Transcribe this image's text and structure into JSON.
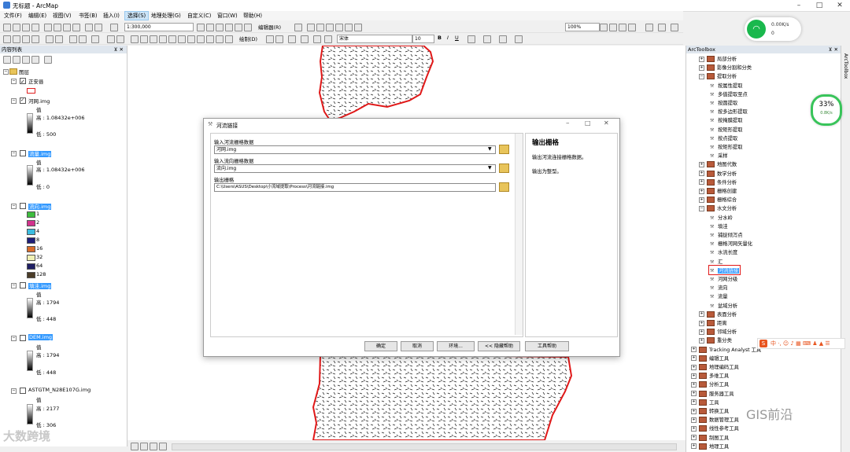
{
  "window": {
    "title": "无标题 - ArcMap"
  },
  "menu": [
    "文件(F)",
    "编辑(E)",
    "视图(V)",
    "书签(B)",
    "插入(I)",
    "选择(S)",
    "地理处理(G)",
    "自定义(C)",
    "窗口(W)",
    "帮助(H)"
  ],
  "toolbar": {
    "scale": "1:300,000",
    "editor": "编辑器(R)",
    "zoom": "100%",
    "drawing": "绘制(D)",
    "font": "宋体",
    "font_size": "10"
  },
  "network": {
    "up": "0.00K/s",
    "down": "0"
  },
  "toc": {
    "title": "内容列表",
    "root": "图层",
    "layers": [
      {
        "name": "正安县"
      },
      {
        "name": "河网.img",
        "value_label": "值",
        "high": "高 : 1.08432e+006",
        "low": "低 : 500"
      },
      {
        "name": "流量.img",
        "value_label": "值",
        "high": "高 : 1.08432e+006",
        "low": "低 : 0"
      },
      {
        "name": "流向.img",
        "classes": [
          "1",
          "2",
          "4",
          "8",
          "16",
          "32",
          "64",
          "128"
        ]
      },
      {
        "name": "填洼.img",
        "value_label": "值",
        "high": "高 : 1794",
        "low": "低 : 448"
      },
      {
        "name": "DEM.img",
        "value_label": "值",
        "high": "高 : 1794",
        "low": "低 : 448"
      },
      {
        "name": "ASTGTM_N28E107G.img",
        "value_label": "值",
        "high": "高 : 2177",
        "low": "低 : 306"
      }
    ],
    "colors": {
      "1": "#3ebc3e",
      "2": "#d2328c",
      "4": "#3cbde0",
      "8": "#1e1e78",
      "16": "#d96c2a",
      "32": "#f0f0b4",
      "64": "#1e1e64",
      "128": "#4b3c28"
    }
  },
  "dialog": {
    "title": "河流链接",
    "label1": "输入河流栅格数据",
    "value1": "河网.img",
    "label2": "输入流向栅格数据",
    "value2": "流向.img",
    "label3": "输出栅格",
    "value3": "C:\\Users\\ASUS\\Desktop\\小流域提取\\Process\\河流链接.img",
    "help_title": "输出栅格",
    "help_text1": "输出河流连接栅格数据。",
    "help_text2": "输出为整型。",
    "buttons": {
      "ok": "确定",
      "cancel": "取消",
      "env": "环境...",
      "hide_help": "<< 隐藏帮助",
      "tool_help": "工具帮助"
    }
  },
  "toolbox": {
    "title": "ArcToolbox",
    "items": [
      {
        "label": "局部分析",
        "level": 1,
        "type": "set"
      },
      {
        "label": "影像分割和分类",
        "level": 1,
        "type": "set"
      },
      {
        "label": "提取分析",
        "level": 1,
        "type": "set",
        "open": true
      },
      {
        "label": "按属性提取",
        "level": 2,
        "type": "tool"
      },
      {
        "label": "多值提取至点",
        "level": 2,
        "type": "tool"
      },
      {
        "label": "按圆提取",
        "level": 2,
        "type": "tool"
      },
      {
        "label": "按多边形提取",
        "level": 2,
        "type": "tool"
      },
      {
        "label": "按掩膜提取",
        "level": 2,
        "type": "tool"
      },
      {
        "label": "按矩形提取",
        "level": 2,
        "type": "tool"
      },
      {
        "label": "按点提取",
        "level": 2,
        "type": "tool"
      },
      {
        "label": "按矩形提取",
        "level": 2,
        "type": "tool"
      },
      {
        "label": "采样",
        "level": 2,
        "type": "tool"
      },
      {
        "label": "地图代数",
        "level": 1,
        "type": "set"
      },
      {
        "label": "数学分析",
        "level": 1,
        "type": "set"
      },
      {
        "label": "条件分析",
        "level": 1,
        "type": "set"
      },
      {
        "label": "栅格创建",
        "level": 1,
        "type": "set"
      },
      {
        "label": "栅格综合",
        "level": 1,
        "type": "set"
      },
      {
        "label": "水文分析",
        "level": 1,
        "type": "set",
        "open": true
      },
      {
        "label": "分水岭",
        "level": 2,
        "type": "tool"
      },
      {
        "label": "填洼",
        "level": 2,
        "type": "tool"
      },
      {
        "label": "捕捉倾泻点",
        "level": 2,
        "type": "tool"
      },
      {
        "label": "栅格河网矢量化",
        "level": 2,
        "type": "tool"
      },
      {
        "label": "水流长度",
        "level": 2,
        "type": "tool"
      },
      {
        "label": "汇",
        "level": 2,
        "type": "tool"
      },
      {
        "label": "河流链接",
        "level": 2,
        "type": "tool",
        "selected": true
      },
      {
        "label": "河网分级",
        "level": 2,
        "type": "tool"
      },
      {
        "label": "流向",
        "level": 2,
        "type": "tool"
      },
      {
        "label": "流量",
        "level": 2,
        "type": "tool"
      },
      {
        "label": "盆域分析",
        "level": 2,
        "type": "tool"
      },
      {
        "label": "表面分析",
        "level": 1,
        "type": "set"
      },
      {
        "label": "距离",
        "level": 1,
        "type": "set"
      },
      {
        "label": "邻域分析",
        "level": 1,
        "type": "set"
      },
      {
        "label": "重分类",
        "level": 1,
        "type": "set"
      },
      {
        "label": "Tracking Analyst 工具",
        "level": 0,
        "type": "box"
      },
      {
        "label": "编辑工具",
        "level": 0,
        "type": "box"
      },
      {
        "label": "地理编码工具",
        "level": 0,
        "type": "box"
      },
      {
        "label": "多维工具",
        "level": 0,
        "type": "box"
      },
      {
        "label": "分析工具",
        "level": 0,
        "type": "box"
      },
      {
        "label": "服务器工具",
        "level": 0,
        "type": "box"
      },
      {
        "label": "工具",
        "level": 0,
        "type": "box"
      },
      {
        "label": "转换工具",
        "level": 0,
        "type": "box"
      },
      {
        "label": "数据管理工具",
        "level": 0,
        "type": "box"
      },
      {
        "label": "线性参考工具",
        "level": 0,
        "type": "box"
      },
      {
        "label": "制图工具",
        "level": 0,
        "type": "box"
      },
      {
        "label": "地理工具",
        "level": 0,
        "type": "box"
      }
    ]
  },
  "gauge": {
    "percent": "33%",
    "speed": "0.8K/s"
  },
  "watermark": {
    "left": "大数跨境",
    "right": "GIS前沿"
  }
}
